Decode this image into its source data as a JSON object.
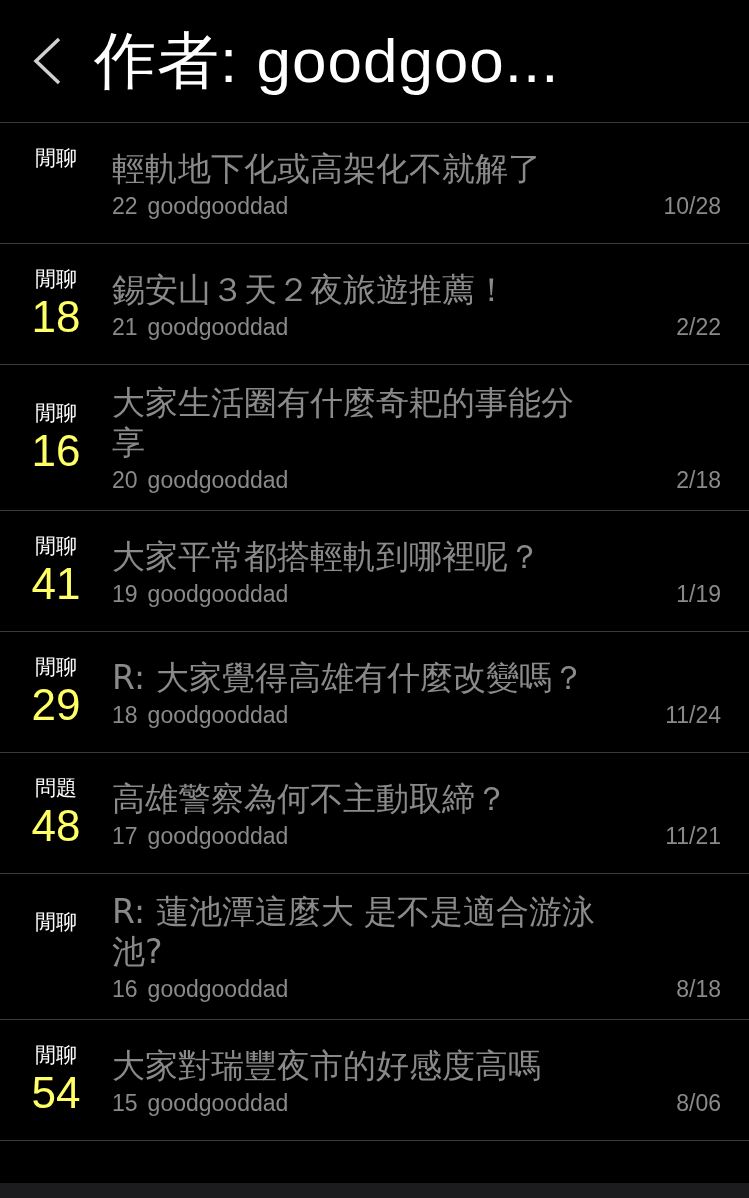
{
  "header": {
    "title": "作者: goodgoo..."
  },
  "posts": [
    {
      "category": "閒聊",
      "title": "輕軌地下化或高架化不就解了",
      "number": "22",
      "author": "goodgooddad",
      "date": "10/28"
    },
    {
      "category": "閒聊",
      "count": "18",
      "title": "錫安山３天２夜旅遊推薦！",
      "number": "21",
      "author": "goodgooddad",
      "date": "2/22"
    },
    {
      "category": "閒聊",
      "count": "16",
      "title": "大家生活圈有什麼奇耙的事能分享",
      "number": "20",
      "author": "goodgooddad",
      "date": "2/18"
    },
    {
      "category": "閒聊",
      "count": "41",
      "title": "大家平常都搭輕軌到哪裡呢？",
      "number": "19",
      "author": "goodgooddad",
      "date": "1/19"
    },
    {
      "category": "閒聊",
      "count": "29",
      "title": "R: 大家覺得高雄有什麼改變嗎？",
      "number": "18",
      "author": "goodgooddad",
      "date": "11/24"
    },
    {
      "category": "問題",
      "count": "48",
      "title": "高雄警察為何不主動取締？",
      "number": "17",
      "author": "goodgooddad",
      "date": "11/21"
    },
    {
      "category": "閒聊",
      "title": "R: 蓮池潭這麼大 是不是適合游泳池?",
      "number": "16",
      "author": "goodgooddad",
      "date": "8/18"
    },
    {
      "category": "閒聊",
      "count": "54",
      "title": "大家對瑞豐夜市的好感度高嗎",
      "number": "15",
      "author": "goodgooddad",
      "date": "8/06"
    }
  ]
}
